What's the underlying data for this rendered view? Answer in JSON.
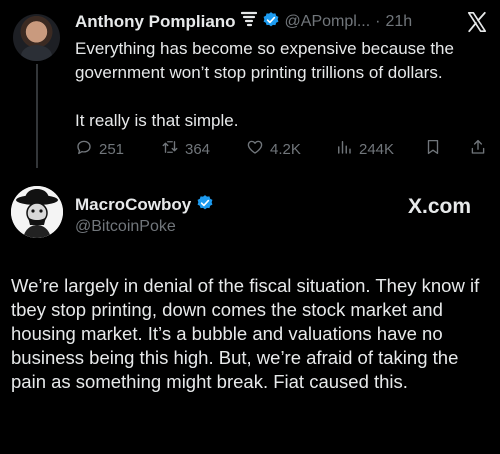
{
  "quoted_tweet": {
    "author_name": "Anthony Pompliano",
    "handle": "@APompl...",
    "separator": "·",
    "time": "21h",
    "text": "Everything has become so expensive because the government won’t stop printing trillions of dollars.\n\nIt really is that simple.",
    "stats": {
      "replies": "251",
      "retweets": "364",
      "likes": "4.2K",
      "views": "244K"
    },
    "icons": {
      "badge": "tornado-icon",
      "verified": "verified-badge-icon",
      "brand": "x-logo-icon"
    }
  },
  "main_tweet": {
    "author_name": "MacroCowboy",
    "handle": "@BitcoinPoke",
    "brand_label": "X.com",
    "text": "We’re largely in denial of the fiscal situation. They know if tbey stop printing, down comes the stock market and housing market. It’s a bubble and valuations have no business being this high. But, we’re afraid of taking the pain as something might break. Fiat caused this."
  },
  "colors": {
    "background": "#000000",
    "text": "#e7e9ea",
    "muted": "#71767b",
    "verified_blue": "#1d9bf0"
  }
}
